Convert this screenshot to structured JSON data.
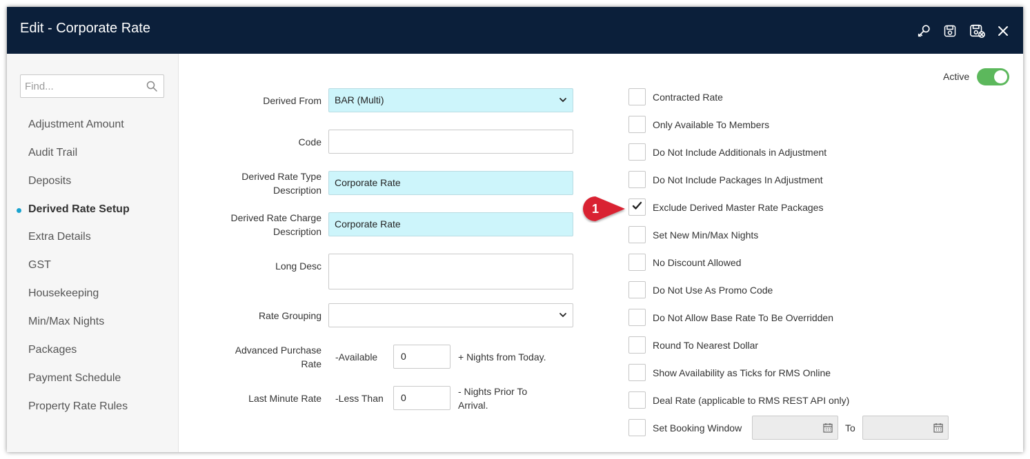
{
  "window": {
    "title": "Edit - Corporate Rate"
  },
  "toolbar": {
    "icons": [
      "key-icon",
      "save-icon",
      "save-close-icon",
      "close-icon"
    ]
  },
  "sidebar": {
    "search_placeholder": "Find...",
    "items": [
      {
        "label": "Adjustment Amount",
        "active": false
      },
      {
        "label": "Audit Trail",
        "active": false
      },
      {
        "label": "Deposits",
        "active": false
      },
      {
        "label": "Derived Rate Setup",
        "active": true
      },
      {
        "label": "Extra Details",
        "active": false
      },
      {
        "label": "GST",
        "active": false
      },
      {
        "label": "Housekeeping",
        "active": false
      },
      {
        "label": "Min/Max Nights",
        "active": false
      },
      {
        "label": "Packages",
        "active": false
      },
      {
        "label": "Payment Schedule",
        "active": false
      },
      {
        "label": "Property Rate Rules",
        "active": false
      }
    ]
  },
  "form": {
    "derived_from": {
      "label": "Derived From",
      "value": "BAR (Multi)"
    },
    "code": {
      "label": "Code",
      "value": ""
    },
    "type_desc": {
      "label1": "Derived Rate Type",
      "label2": "Description",
      "value": "Corporate Rate"
    },
    "charge_desc": {
      "label1": "Derived Rate Charge",
      "label2": "Description",
      "value": "Corporate Rate"
    },
    "long_desc": {
      "label": "Long Desc",
      "value": ""
    },
    "rate_grouping": {
      "label": "Rate Grouping",
      "value": ""
    },
    "advanced_purchase": {
      "label1": "Advanced Purchase",
      "label2": "Rate",
      "prefix": "-Available",
      "value": "0",
      "suffix": "+ Nights from Today."
    },
    "last_minute": {
      "label": "Last Minute Rate",
      "prefix": "-Less Than",
      "value": "0",
      "suffix1": "- Nights Prior To",
      "suffix2": "Arrival."
    }
  },
  "active": {
    "label": "Active",
    "on": true,
    "color": "#5cb85c"
  },
  "options": [
    {
      "label": "Contracted Rate",
      "checked": false
    },
    {
      "label": "Only Available To Members",
      "checked": false
    },
    {
      "label": "Do Not Include Additionals in Adjustment",
      "checked": false
    },
    {
      "label": "Do Not Include Packages In Adjustment",
      "checked": false
    },
    {
      "label": "Exclude Derived Master Rate Packages",
      "checked": true
    },
    {
      "label": "Set New Min/Max Nights",
      "checked": false
    },
    {
      "label": "No Discount Allowed",
      "checked": false
    },
    {
      "label": "Do Not Use As Promo Code",
      "checked": false
    },
    {
      "label": "Do Not Allow Base Rate To Be Overridden",
      "checked": false
    },
    {
      "label": "Round To Nearest Dollar",
      "checked": false
    },
    {
      "label": "Show Availability as Ticks for RMS Online",
      "checked": false
    },
    {
      "label": "Deal Rate (applicable to RMS REST API only)",
      "checked": false
    }
  ],
  "booking_window": {
    "label": "Set Booking Window",
    "checked": false,
    "to_label": "To",
    "from_value": "",
    "to_value": ""
  },
  "callout": {
    "number": "1",
    "color": "#d92232"
  },
  "colors": {
    "titlebar": "#0b1f3a",
    "accent": "#1aa3cf",
    "input_highlight": "#cdf5fb"
  }
}
